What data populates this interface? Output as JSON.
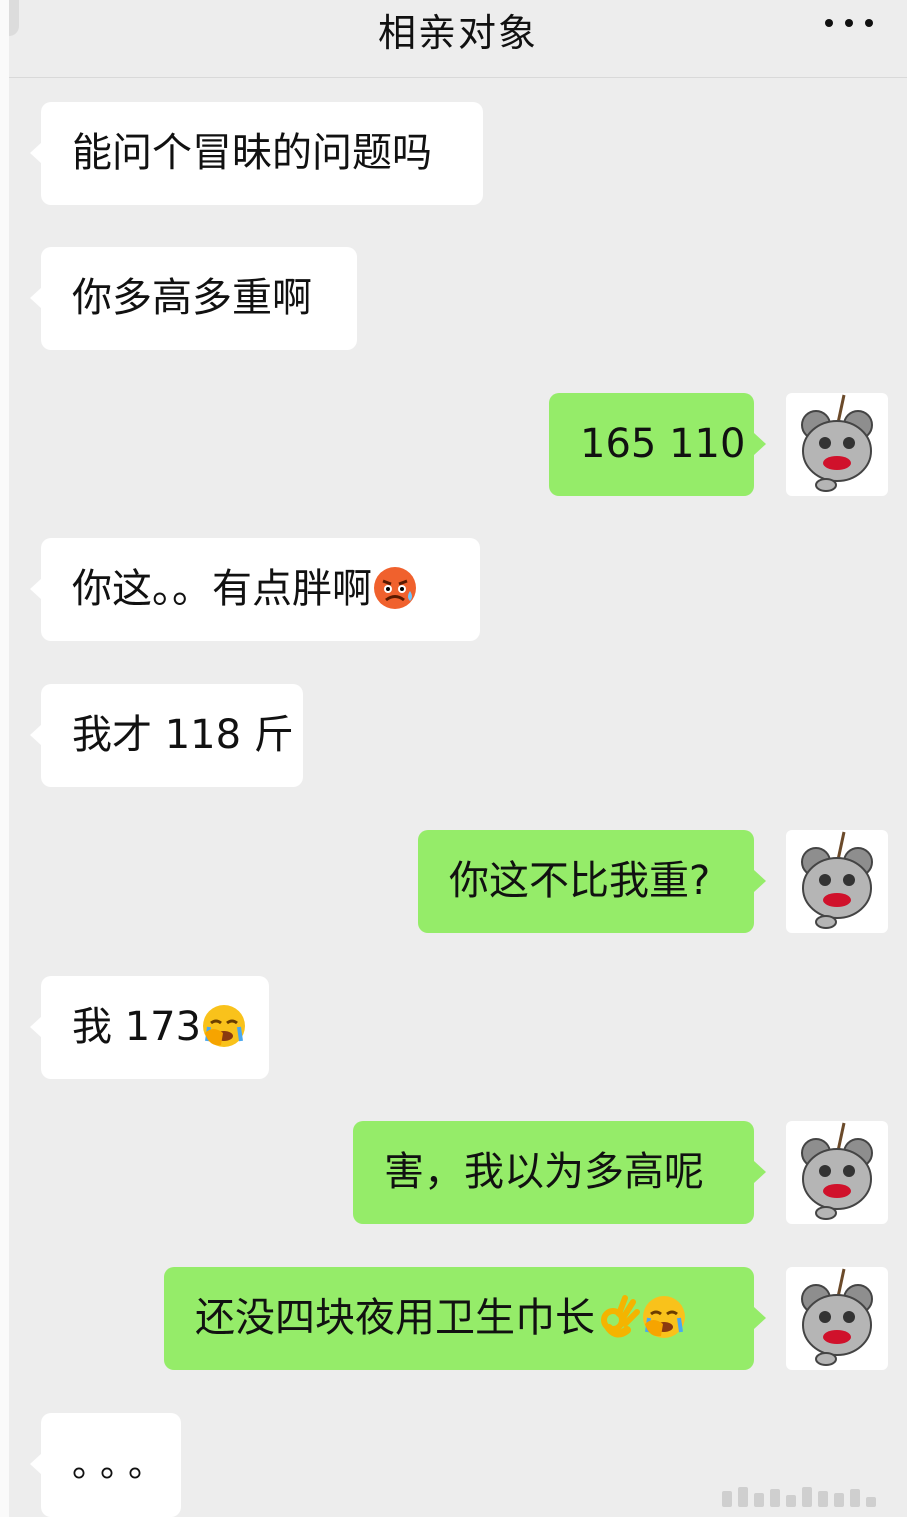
{
  "header": {
    "title": "相亲对象",
    "more_icon": "more-dots-icon"
  },
  "messages": [
    {
      "side": "in",
      "text": "能问个冒昧的问题吗",
      "emojis": []
    },
    {
      "side": "in",
      "text": "你多高多重啊",
      "emojis": []
    },
    {
      "side": "out",
      "text": "165 110",
      "emojis": []
    },
    {
      "side": "in",
      "text": "你这。。有点胖啊",
      "emojis": [
        "angry-sweat-emoji"
      ]
    },
    {
      "side": "in",
      "text": "我才 118 斤",
      "emojis": []
    },
    {
      "side": "out",
      "text": "你这不比我重?",
      "emojis": []
    },
    {
      "side": "in",
      "text": "我 173",
      "emojis": [
        "facepalm-cry-emoji"
      ]
    },
    {
      "side": "out",
      "text": "害，我以为多高呢",
      "emojis": []
    },
    {
      "side": "out",
      "text": "还没四块夜用卫生巾长",
      "emojis": [
        "ok-hand-emoji",
        "facepalm-cry-emoji"
      ]
    },
    {
      "side": "in",
      "text": "。。。",
      "emojis": []
    }
  ],
  "colors": {
    "background": "#ededed",
    "incoming_bubble": "#ffffff",
    "outgoing_bubble": "#95ec69"
  },
  "avatar_icon": "mouse-sticker-avatar-icon"
}
